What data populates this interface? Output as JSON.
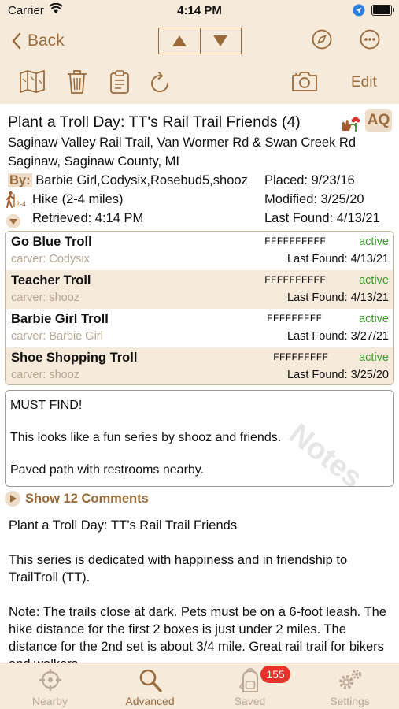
{
  "status_bar": {
    "carrier": "Carrier",
    "time": "4:14 PM"
  },
  "nav": {
    "back_label": "Back"
  },
  "toolbar": {
    "edit_label": "Edit"
  },
  "header": {
    "title": "Plant a Troll Day: TT's Rail Trail Friends (4)",
    "badge": "AQ",
    "location_line1": "Saginaw Valley Rail Trail, Van Wormer Rd & Swan Creek Rd",
    "location_line2": "Saginaw, Saginaw County, MI",
    "by_label": "By:",
    "by_value": "Barbie Girl,Codysix,Rosebud5,shooz",
    "placed": "Placed: 9/23/16",
    "hike_sub": "2-4",
    "hike": "Hike (2-4 miles)",
    "modified": "Modified: 3/25/20",
    "retrieved": "Retrieved: 4:14 PM",
    "last_found": "Last Found: 4/13/21"
  },
  "boxes": [
    {
      "name": "Go Blue Troll",
      "carver": "carver: Codysix",
      "code": "FFFFFFFFFF",
      "status": "active",
      "last_found": "Last Found: 4/13/21"
    },
    {
      "name": "Teacher Troll",
      "carver": "carver: shooz",
      "code": "FFFFFFFFFF",
      "status": "active",
      "last_found": "Last Found: 4/13/21"
    },
    {
      "name": "Barbie Girl Troll",
      "carver": "carver: Barbie Girl",
      "code": "FFFFFFFFF",
      "status": "active",
      "last_found": "Last Found: 3/27/21"
    },
    {
      "name": "Shoe Shopping Troll",
      "carver": "carver: shooz",
      "code": "FFFFFFFFF",
      "status": "active",
      "last_found": "Last Found: 3/25/20"
    }
  ],
  "notes": {
    "watermark": "Notes",
    "lines": [
      "MUST FIND!",
      "This looks like a fun series by shooz and friends.",
      "Paved path with restrooms nearby."
    ]
  },
  "comments_label": "Show 12 Comments",
  "description": [
    "Plant a Troll Day: TT’s Rail Trail Friends",
    "This series is dedicated with happiness and in friendship to TrailTroll (TT).",
    "Note: The trails close at dark. Pets must be on a 6-foot leash. The hike distance for the first 2 boxes is just under 2 miles. The distance for the 2nd set is about 3/4 mile. Great rail trail for bikers and walkers."
  ],
  "tabs": [
    {
      "label": "Nearby",
      "icon": "crosshair-icon"
    },
    {
      "label": "Advanced",
      "icon": "magnifier-icon"
    },
    {
      "label": "Saved",
      "icon": "backpack-icon"
    },
    {
      "label": "Settings",
      "icon": "gears-icon"
    }
  ],
  "saved_badge": "155",
  "colors": {
    "accent": "#9b6a3a",
    "parchment": "#f6eadb",
    "active": "#3a9a2a",
    "badge": "#e8322a"
  }
}
